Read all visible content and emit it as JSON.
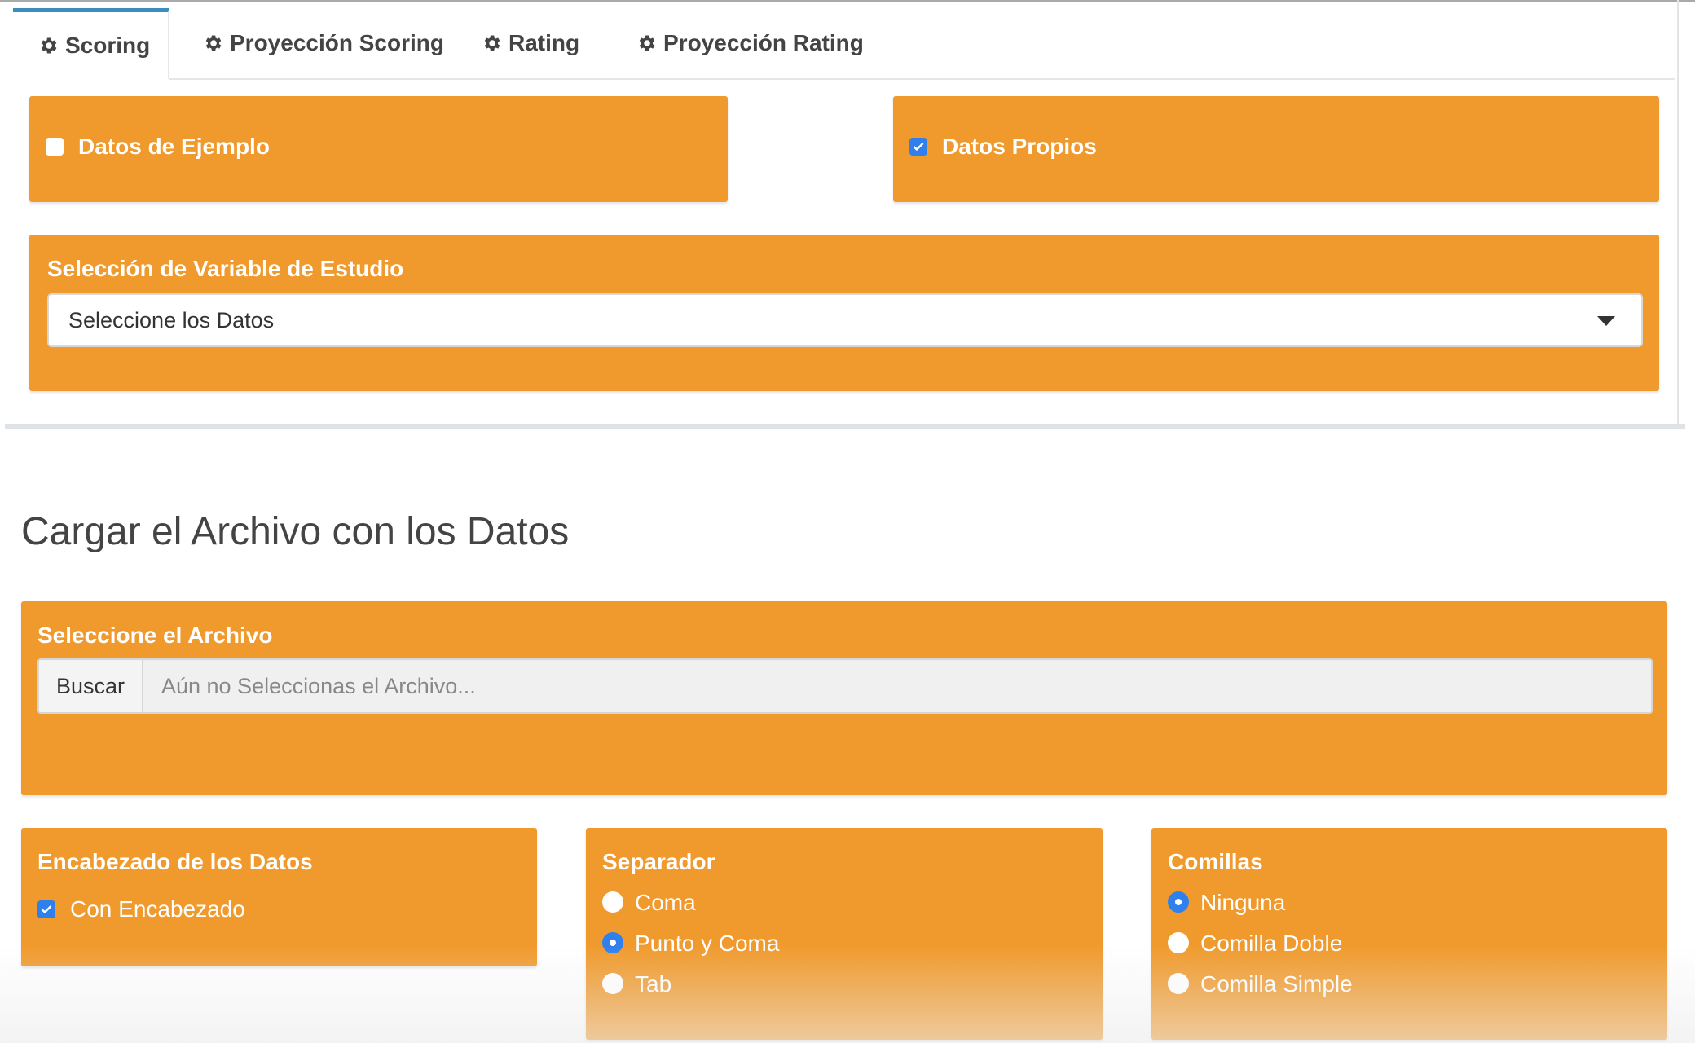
{
  "tabs": [
    {
      "label": "Scoring",
      "icon": "gear-icon",
      "active": true
    },
    {
      "label": "Proyección Scoring",
      "icon": "gear-icon",
      "active": false
    },
    {
      "label": "Rating",
      "icon": "gear-icon",
      "active": false
    },
    {
      "label": "Proyección Rating",
      "icon": "gear-icon",
      "active": false
    }
  ],
  "data_source": {
    "sample": {
      "label": "Datos de Ejemplo",
      "checked": false
    },
    "own": {
      "label": "Datos Propios",
      "checked": true
    }
  },
  "variable_selection": {
    "title": "Selección de Variable de Estudio",
    "value": "Seleccione los Datos"
  },
  "upload": {
    "section_title": "Cargar el Archivo con los Datos",
    "file_title": "Seleccione el Archivo",
    "browse_label": "Buscar",
    "placeholder": "Aún no Seleccionas el Archivo..."
  },
  "header_box": {
    "title": "Encabezado de los Datos",
    "checkbox_label": "Con Encabezado",
    "checked": true
  },
  "separator": {
    "title": "Separador",
    "options": [
      "Coma",
      "Punto y Coma",
      "Tab"
    ],
    "selected": "Punto y Coma"
  },
  "quotes": {
    "title": "Comillas",
    "options": [
      "Ninguna",
      "Comilla Doble",
      "Comilla Simple"
    ],
    "selected": "Ninguna"
  },
  "colors": {
    "box_orange": "#f09a2e",
    "accent_blue": "#2f80ed",
    "tab_active_border": "#3c8dbc"
  }
}
